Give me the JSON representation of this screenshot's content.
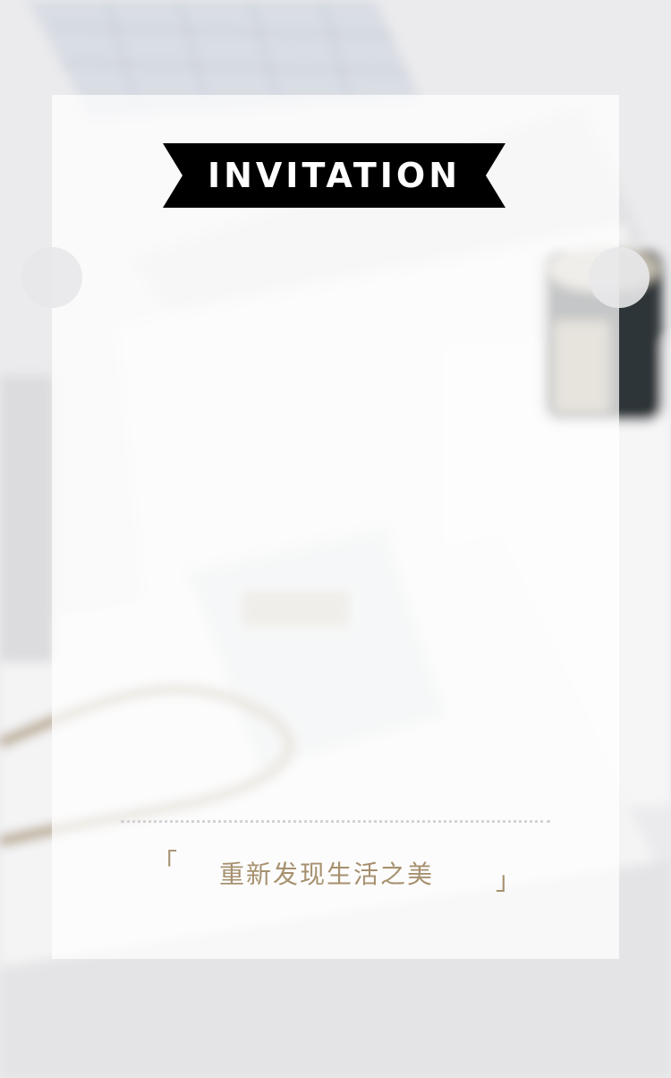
{
  "header": {
    "title": "INVITATION"
  },
  "footer": {
    "open_bracket": "「",
    "tagline": "重新发现生活之美",
    "close_bracket": "」"
  },
  "colors": {
    "ribbon": "#000000",
    "ribbon_text": "#ffffff",
    "accent_gold": "#a6906e",
    "divider": "#d3d3d6"
  },
  "background": {
    "description_icon": "photo-background-icon"
  }
}
